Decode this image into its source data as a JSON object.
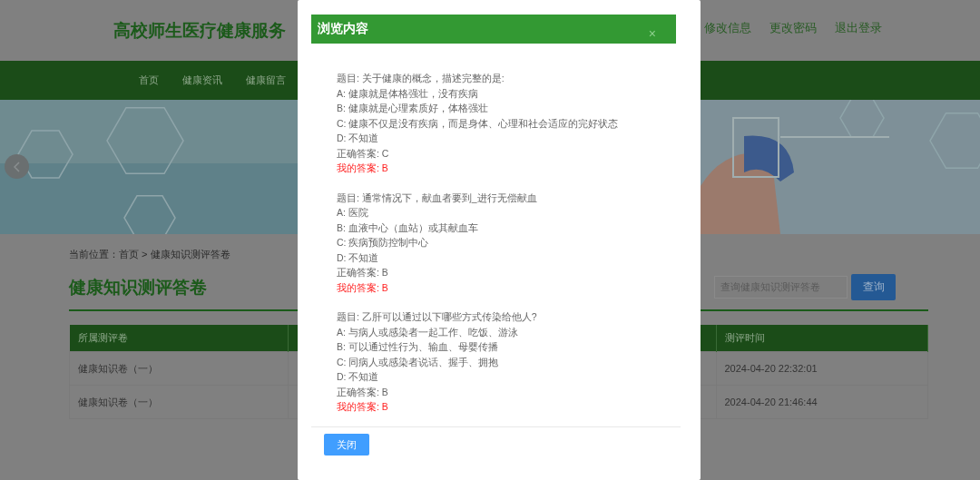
{
  "header": {
    "title": "高校师生医疗健康服务",
    "links": [
      "修改信息",
      "更改密码",
      "退出登录"
    ]
  },
  "nav": {
    "items": [
      "首页",
      "健康资讯",
      "健康留言"
    ]
  },
  "breadcrumb": "当前位置：首页 > 健康知识测评答卷",
  "section": {
    "title": "健康知识测评答卷",
    "search": {
      "placeholder": "查询健康知识测评答卷",
      "button": "查询"
    }
  },
  "table": {
    "columns": [
      "所属测评卷",
      "测评时间"
    ],
    "rows": [
      {
        "cells": [
          "健康知识卷（一）",
          "2024-04-20 22:32:01"
        ]
      },
      {
        "cells": [
          "健康知识卷（一）",
          "2024-04-20 21:46:44"
        ]
      }
    ]
  },
  "dialog": {
    "title": "浏览内容",
    "close": "×",
    "button": "关闭",
    "questions": [
      {
        "question": "题目: 关于健康的概念，描述完整的是:",
        "options": [
          "A: 健康就是体格强壮，没有疾病",
          "B: 健康就是心理素质好，体格强壮",
          "C: 健康不仅是没有疾病，而是身体、心理和社会适应的完好状态",
          "D: 不知道"
        ],
        "correct": "正确答案: C",
        "mine": "我的答案: B"
      },
      {
        "question": "题目: 通常情况下，献血者要到_进行无偿献血",
        "options": [
          "A: 医院",
          "B: 血液中心（血站）或其献血车",
          "C: 疾病预防控制中心",
          "D: 不知道"
        ],
        "correct": "正确答案: B",
        "mine": "我的答案: B"
      },
      {
        "question": "题目: 乙肝可以通过以下哪些方式传染给他人?",
        "options": [
          "A: 与病人或感染者一起工作、吃饭、游泳",
          "B: 可以通过性行为、输血、母婴传播",
          "C: 同病人或感染者说话、握手、拥抱",
          "D: 不知道"
        ],
        "correct": "正确答案: B",
        "mine": "我的答案: B"
      }
    ]
  }
}
